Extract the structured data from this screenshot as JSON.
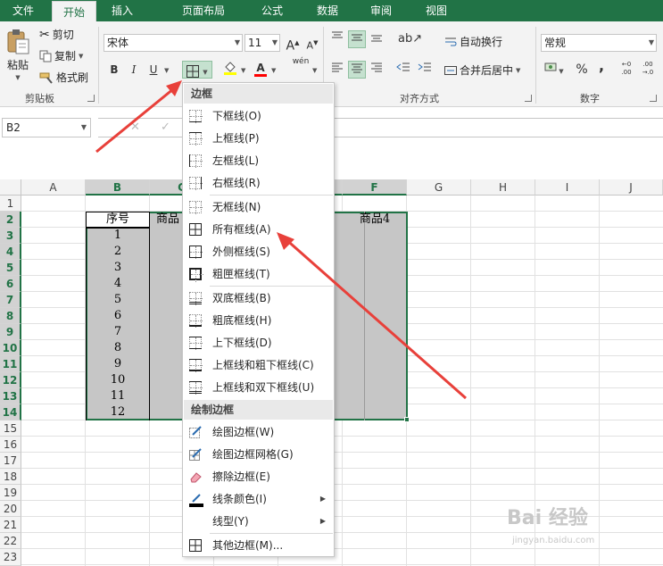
{
  "tabs": [
    "文件",
    "开始",
    "插入",
    "页面布局",
    "公式",
    "数据",
    "审阅",
    "视图"
  ],
  "clipboard": {
    "paste": "粘贴",
    "cut": "剪切",
    "copy": "复制",
    "format_painter": "格式刷",
    "group_label": "剪贴板"
  },
  "font": {
    "name": "宋体",
    "size": "11",
    "bold": "B",
    "italic": "I",
    "underline": "U",
    "grow": "A",
    "shrink": "A",
    "color_letter": "A",
    "phonetic": "wén"
  },
  "alignment": {
    "wrap_text": "自动换行",
    "merge_center": "合并后居中",
    "group_label": "对齐方式"
  },
  "number": {
    "format": "常规",
    "percent": "%",
    "comma": ",",
    "group_label": "数字"
  },
  "name_box": "B2",
  "columns": [
    "A",
    "B",
    "C",
    "D",
    "E",
    "F",
    "G",
    "H",
    "I",
    "J"
  ],
  "rows": [
    "1",
    "2",
    "3",
    "4",
    "5",
    "6",
    "7",
    "8",
    "9",
    "10",
    "11",
    "12",
    "13",
    "14",
    "15",
    "16",
    "17",
    "18",
    "19",
    "20",
    "21",
    "22",
    "23"
  ],
  "cells": {
    "b2": "序号",
    "c2": "商品",
    "f2": "商品4",
    "b_values": [
      "1",
      "2",
      "3",
      "4",
      "5",
      "6",
      "7",
      "8",
      "9",
      "10",
      "11",
      "12"
    ]
  },
  "menu": {
    "section_borders": "边框",
    "items": [
      "下框线(O)",
      "上框线(P)",
      "左框线(L)",
      "右框线(R)",
      "无框线(N)",
      "所有框线(A)",
      "外侧框线(S)",
      "粗匣框线(T)",
      "双底框线(B)",
      "粗底框线(H)",
      "上下框线(D)",
      "上框线和粗下框线(C)",
      "上框线和双下框线(U)"
    ],
    "section_draw": "绘制边框",
    "draw_items": [
      "绘图边框(W)",
      "绘图边框网格(G)",
      "擦除边框(E)",
      "线条颜色(I)",
      "线型(Y)",
      "其他边框(M)..."
    ]
  },
  "watermark": {
    "main": "Bai 经验",
    "sub": "jingyan.baidu.com"
  }
}
